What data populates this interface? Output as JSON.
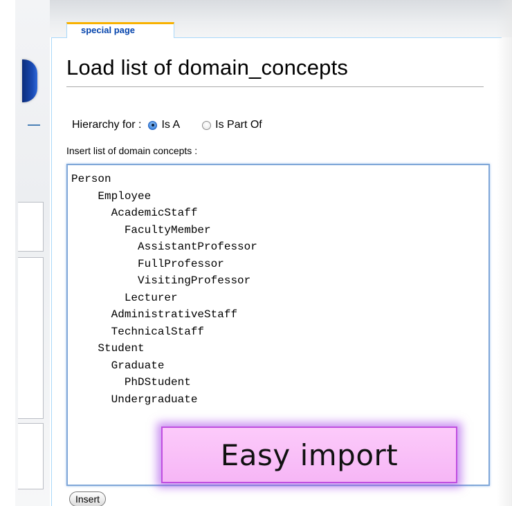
{
  "tab": {
    "label": "special page"
  },
  "page": {
    "title": "Load list of domain_concepts"
  },
  "hierarchy": {
    "label": "Hierarchy for :",
    "options": [
      {
        "label": "Is A",
        "selected": true
      },
      {
        "label": "Is Part Of",
        "selected": false
      }
    ]
  },
  "concepts": {
    "label": "Insert list of domain concepts :",
    "value": "Person\n    Employee\n      AcademicStaff\n        FacultyMember\n          AssistantProfessor\n          FullProfessor\n          VisitingProfessor\n        Lecturer\n      AdministrativeStaff\n      TechnicalStaff\n    Student\n      Graduate\n        PhDStudent\n      Undergraduate"
  },
  "callout": {
    "text": "Easy import"
  },
  "actions": {
    "insert_label": "Insert"
  },
  "colors": {
    "link": "#0645ad",
    "tab_accent": "#f8b100",
    "callout_fill": "#f9bff8",
    "callout_glow": "#a03ce6",
    "logo_blue": "#1a4bb5"
  },
  "icons": {
    "radio_selected": "radio-checked-icon",
    "radio_unselected": "radio-unchecked-icon"
  }
}
